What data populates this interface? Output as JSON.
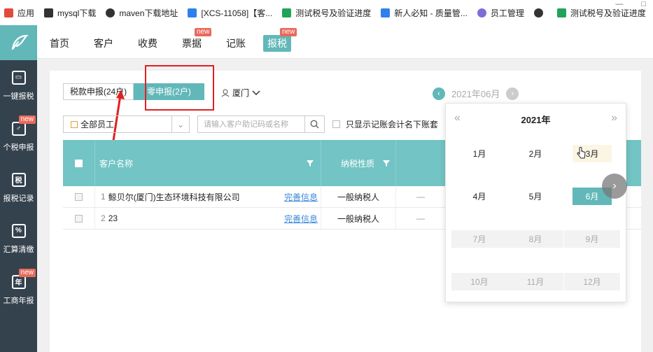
{
  "bookmarks": [
    {
      "label": "应用",
      "icon": "apps-grid-icon",
      "color": "#e24a3b"
    },
    {
      "label": "mysql下载",
      "icon": "mysql-icon",
      "color": "#333333"
    },
    {
      "label": "maven下载地址",
      "icon": "globe-icon",
      "color": "#333333"
    },
    {
      "label": "[XCS-11058]【客...",
      "icon": "jira-icon",
      "color": "#2f80ed"
    },
    {
      "label": "测试税号及验证进度",
      "icon": "sheets-icon",
      "color": "#22a35a"
    },
    {
      "label": "新人必知 - 质量管...",
      "icon": "confluence-icon",
      "color": "#2f80ed"
    },
    {
      "label": "员工管理",
      "icon": "app-icon",
      "color": "#7b6fd6"
    },
    {
      "label": "",
      "icon": "globe-icon",
      "color": "#333333"
    },
    {
      "label": "测试税号及验证进度",
      "icon": "sheets-icon",
      "color": "#22a35a"
    }
  ],
  "sidebar": {
    "items": [
      {
        "label": "一键报税",
        "icon": "monitor-icon",
        "badge": ""
      },
      {
        "label": "个税申报",
        "icon": "person-tax-icon",
        "badge": "new"
      },
      {
        "label": "报税记录",
        "icon": "tax-record-icon",
        "badge": ""
      },
      {
        "label": "汇算清缴",
        "icon": "percent-doc-icon",
        "badge": ""
      },
      {
        "label": "工商年报",
        "icon": "calendar-year-icon",
        "badge": "new"
      }
    ]
  },
  "topnav": {
    "items": [
      {
        "label": "首页",
        "badge": ""
      },
      {
        "label": "客户",
        "badge": ""
      },
      {
        "label": "收费",
        "badge": ""
      },
      {
        "label": "票据",
        "badge": "new"
      },
      {
        "label": "记账",
        "badge": ""
      },
      {
        "label": "报税",
        "badge": "new"
      }
    ],
    "active": "报税"
  },
  "tabs": {
    "tax_report": "税款申报(24户)",
    "zero_report": "零申报(2户)"
  },
  "city": "厦门",
  "date_nav": {
    "current": "2021年06月"
  },
  "filters": {
    "staff_select": "全部员工",
    "search_placeholder": "请输入客户助记码或名称",
    "only_show_label": "只显示记账会计名下账套"
  },
  "table": {
    "columns": [
      "客户名称",
      "纳税性质"
    ],
    "rows": [
      {
        "index": "1",
        "name": "鲸贝尔(厦门)生态环境科技有限公司",
        "action": "完善信息",
        "tax_type": "一般纳税人",
        "extra": "—"
      },
      {
        "index": "2",
        "name": "23",
        "action": "完善信息",
        "tax_type": "一般纳税人",
        "extra": "—"
      }
    ]
  },
  "month_picker": {
    "year": "2021年",
    "prev": "«",
    "next": "»",
    "months": [
      {
        "label": "1月",
        "state": "enabled"
      },
      {
        "label": "2月",
        "state": "enabled"
      },
      {
        "label": "3月",
        "state": "hover"
      },
      {
        "label": "4月",
        "state": "enabled"
      },
      {
        "label": "5月",
        "state": "enabled"
      },
      {
        "label": "6月",
        "state": "selected"
      },
      {
        "label": "7月",
        "state": "disabled"
      },
      {
        "label": "8月",
        "state": "disabled"
      },
      {
        "label": "9月",
        "state": "disabled"
      },
      {
        "label": "10月",
        "state": "disabled"
      },
      {
        "label": "11月",
        "state": "disabled"
      },
      {
        "label": "12月",
        "state": "disabled"
      }
    ]
  },
  "colors": {
    "accent": "#62b8b8",
    "header": "#73c4c4",
    "sidebar": "#34424e",
    "badge": "#e86a5c",
    "annotation": "#e02020",
    "link": "#3d8ad8"
  }
}
